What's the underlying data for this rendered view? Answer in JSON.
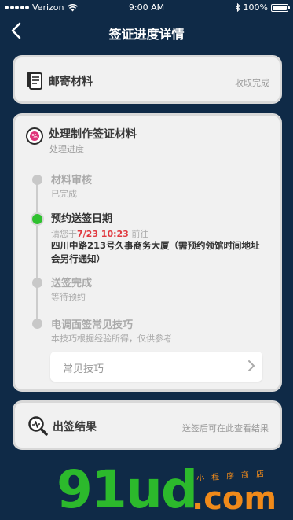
{
  "status_bar": {
    "carrier": "Verizon",
    "time": "9:00 AM",
    "battery": "100%"
  },
  "nav": {
    "title": "签证进度详情"
  },
  "mail": {
    "title": "邮寄材料",
    "status": "收取完成"
  },
  "process": {
    "title": "处理制作签证材料",
    "subtitle": "处理进度",
    "steps": [
      {
        "title": "材料审核",
        "sub": "已完成"
      },
      {
        "title": "预约送签日期",
        "sub_prefix": "请您于",
        "date": "7/23 10:23",
        "sub_suffix": "前往",
        "address": "四川中路213号久事商务大厦（需预约领馆时间地址会另行通知）"
      },
      {
        "title": "送签完成",
        "sub": "等待预约"
      },
      {
        "title": "电调面签常见技巧",
        "sub": "本技巧根据经验所得，仅供参考"
      }
    ],
    "tips_button": "常见技巧"
  },
  "result": {
    "title": "出签结果",
    "hint": "送签后可在此查看结果"
  },
  "watermark": {
    "logo": "91ud",
    "domain": ".com",
    "tagline": "小程序商店"
  },
  "colors": {
    "background": "#0f2a47",
    "active": "#2fc12f",
    "highlight": "#e0383e"
  }
}
